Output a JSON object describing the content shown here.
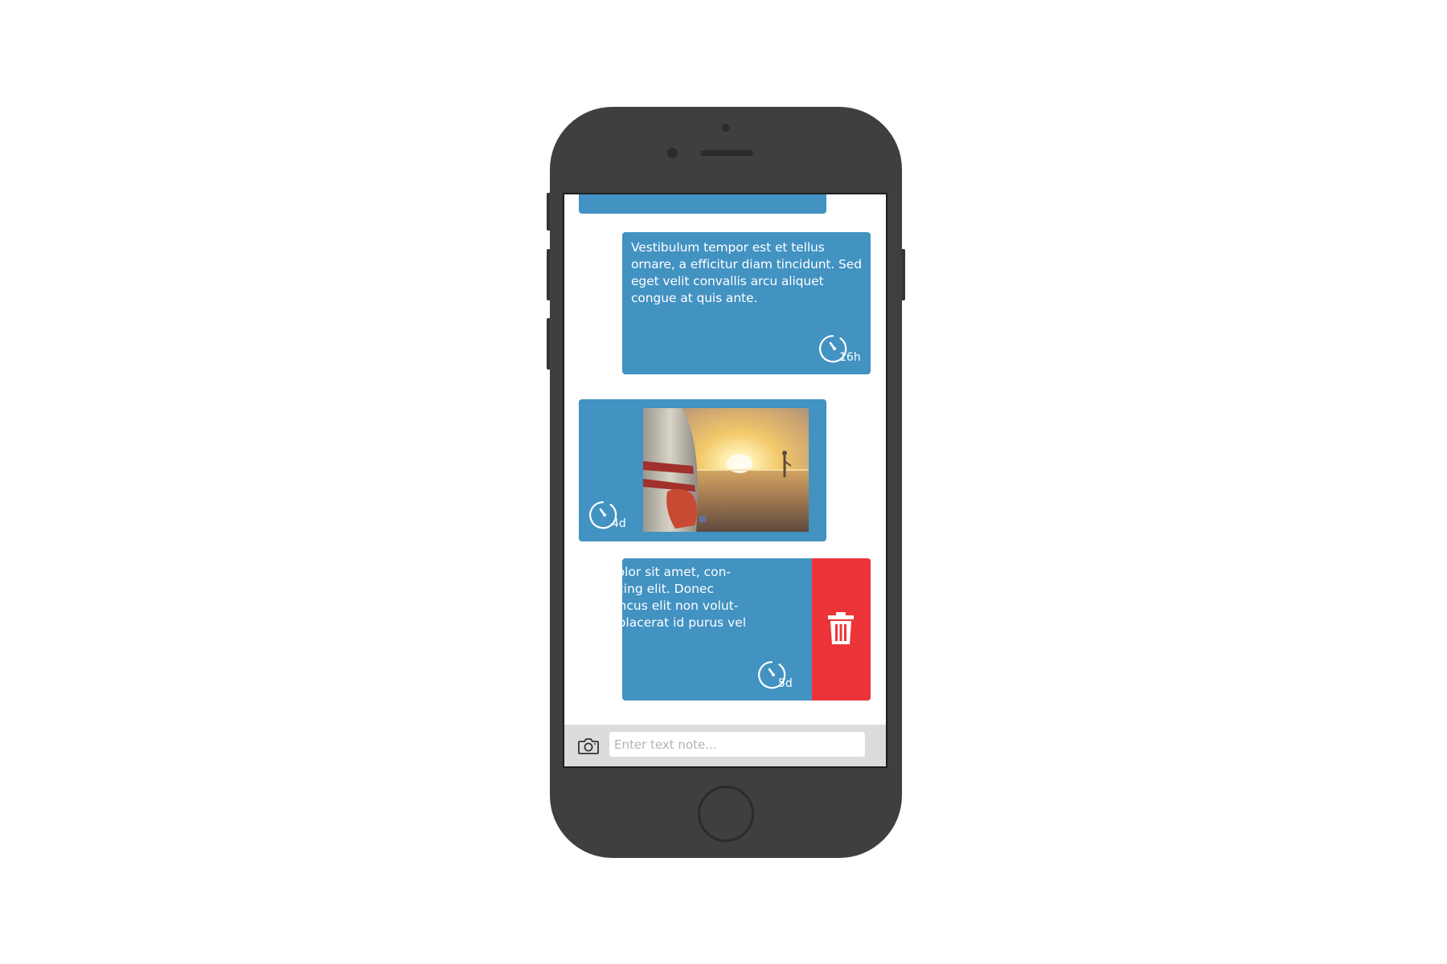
{
  "messages": [
    {
      "id": "msg-top-partial",
      "side": "left",
      "type": "text",
      "text": "",
      "timer": ""
    },
    {
      "id": "msg-1",
      "side": "right",
      "type": "text",
      "text": "Vestibulum tempor est et tellus ornare, a efficitur diam tincidunt. Sed eget velit convallis arcu aliquet congue at quis ante.",
      "timer": "16h"
    },
    {
      "id": "msg-2",
      "side": "left",
      "type": "image",
      "image_icon": "beach-sunset-surfboard-photo",
      "timer": "4d"
    },
    {
      "id": "msg-3",
      "side": "right",
      "type": "text",
      "swiped": true,
      "lines": [
        "psum dolor sit amet, con-",
        "r adipiscing elit. Donec",
        "que rhoncus elit non volut-",
        "asellus placerat id purus vel"
      ],
      "timer": "5d",
      "action_icon": "trash-icon"
    }
  ],
  "input_bar": {
    "camera_icon": "camera-icon",
    "placeholder": "Enter text note...",
    "value": ""
  },
  "colors": {
    "bubble": "#4292c2",
    "delete": "#ec3438",
    "phone_body": "#3e3f41",
    "input_bar": "#dbdcdd"
  }
}
